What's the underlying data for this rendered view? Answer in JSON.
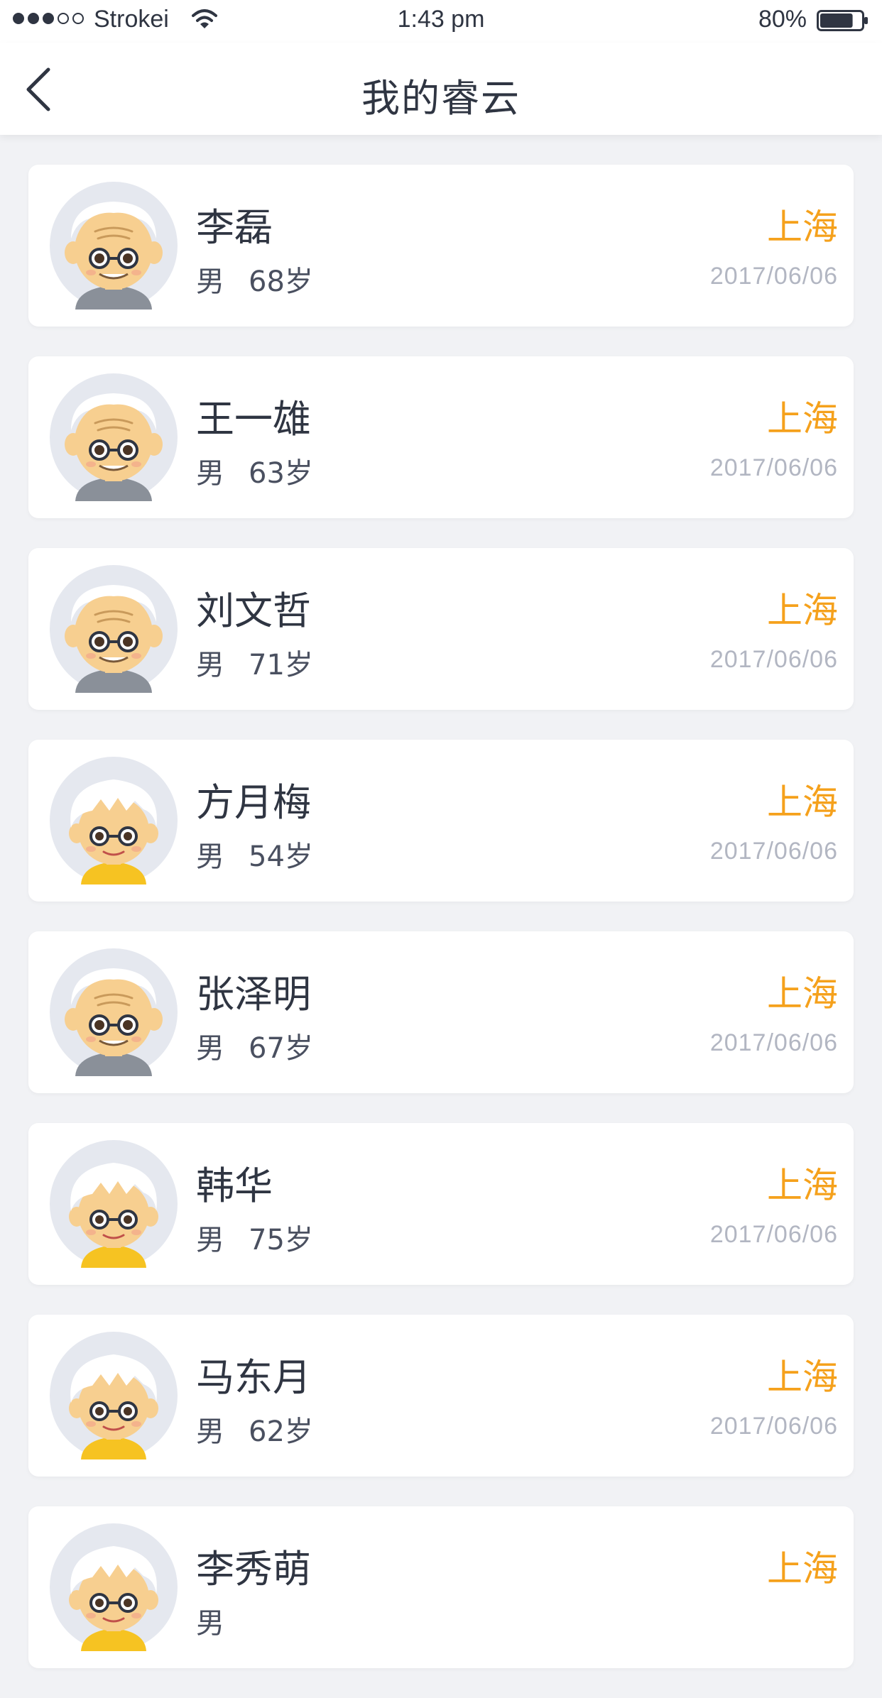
{
  "status_bar": {
    "carrier": "Strokei",
    "time": "1:43 pm",
    "battery": "80%",
    "signal_bars": [
      true,
      true,
      true,
      false,
      false
    ],
    "battery_level": 0.8
  },
  "header": {
    "title": "我的睿云",
    "back_icon": "chevron-left-icon"
  },
  "colors": {
    "accent": "#f5a11c",
    "text_primary": "#2f3542",
    "text_muted": "#b2b6c2",
    "page_bg": "#f1f2f5",
    "card_bg": "#ffffff"
  },
  "list": {
    "items": [
      {
        "name": "李磊",
        "gender": "男",
        "age": "68岁",
        "city": "上海",
        "date": "2017/06/06",
        "avatar": "elderly-man-avatar"
      },
      {
        "name": "王一雄",
        "gender": "男",
        "age": "63岁",
        "city": "上海",
        "date": "2017/06/06",
        "avatar": "elderly-man-avatar"
      },
      {
        "name": "刘文哲",
        "gender": "男",
        "age": "71岁",
        "city": "上海",
        "date": "2017/06/06",
        "avatar": "elderly-man-avatar"
      },
      {
        "name": "方月梅",
        "gender": "男",
        "age": "54岁",
        "city": "上海",
        "date": "2017/06/06",
        "avatar": "elderly-woman-avatar"
      },
      {
        "name": "张泽明",
        "gender": "男",
        "age": "67岁",
        "city": "上海",
        "date": "2017/06/06",
        "avatar": "elderly-man-avatar"
      },
      {
        "name": "韩华",
        "gender": "男",
        "age": "75岁",
        "city": "上海",
        "date": "2017/06/06",
        "avatar": "elderly-woman-avatar"
      },
      {
        "name": "马东月",
        "gender": "男",
        "age": "62岁",
        "city": "上海",
        "date": "2017/06/06",
        "avatar": "elderly-woman-avatar"
      },
      {
        "name": "李秀萌",
        "gender": "男",
        "age": "",
        "city": "上海",
        "date": "",
        "avatar": "elderly-woman-avatar"
      }
    ]
  }
}
